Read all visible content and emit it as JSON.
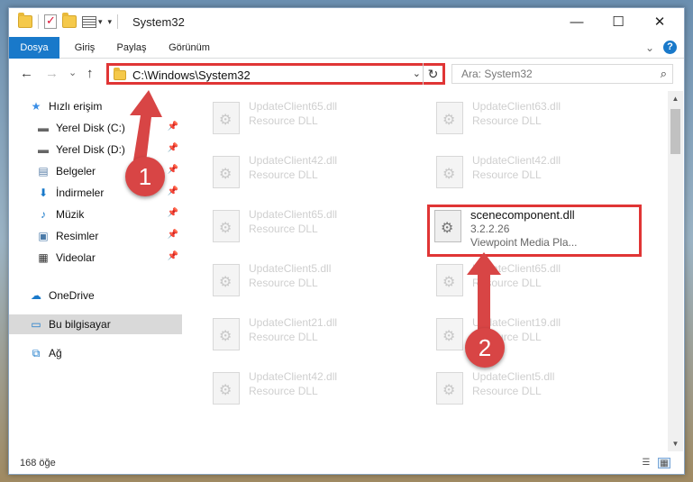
{
  "window": {
    "title": "System32",
    "controls": {
      "minimize": "—",
      "maximize": "☐",
      "close": "✕"
    }
  },
  "ribbon": {
    "tabs": [
      {
        "label": "Dosya",
        "active": true
      },
      {
        "label": "Giriş",
        "active": false
      },
      {
        "label": "Paylaş",
        "active": false
      },
      {
        "label": "Görünüm",
        "active": false
      }
    ],
    "expand_glyph": "⌄",
    "help_glyph": "?"
  },
  "navigation": {
    "back": "←",
    "forward": "→",
    "recent": "⌄",
    "up": "↑",
    "address_path": "C:\\Windows\\System32",
    "address_dropdown": "⌄",
    "refresh": "↻",
    "search_placeholder": "Ara: System32",
    "search_glyph": "⌕"
  },
  "sidebar": {
    "items": [
      {
        "label": "Hızlı erişim",
        "icon": "★",
        "pinned": false
      },
      {
        "label": "Yerel Disk (C:)",
        "icon": "▬",
        "pinned": true
      },
      {
        "label": "Yerel Disk (D:)",
        "icon": "▬",
        "pinned": true
      },
      {
        "label": "Belgeler",
        "icon": "▤",
        "pinned": true
      },
      {
        "label": "İndirmeler",
        "icon": "⬇",
        "pinned": true
      },
      {
        "label": "Müzik",
        "icon": "♪",
        "pinned": true
      },
      {
        "label": "Resimler",
        "icon": "▣",
        "pinned": true
      },
      {
        "label": "Videolar",
        "icon": "▦",
        "pinned": true
      },
      {
        "label": "OneDrive",
        "icon": "☁",
        "pinned": false
      },
      {
        "label": "Bu bilgisayar",
        "icon": "▭",
        "pinned": false,
        "selected": true
      },
      {
        "label": "Ağ",
        "icon": "⧉",
        "pinned": false
      }
    ],
    "pin_glyph": "📌"
  },
  "files": [
    {
      "name": "UpdateClient65.dll",
      "type": "Resource DLL"
    },
    {
      "name": "UpdateClient63.dll",
      "type": "Resource DLL"
    },
    {
      "name": "UpdateClient42.dll",
      "type": "Resource DLL"
    },
    {
      "name": "UpdateClient42.dll",
      "type": "Resource DLL"
    },
    {
      "name": "UpdateClient65.dll",
      "type": "Resource DLL"
    },
    {
      "name": "scenecomponent.dll",
      "version": "3.2.2.26",
      "company": "Viewpoint Media Pla...",
      "highlighted": true
    },
    {
      "name": "UpdateClient5.dll",
      "type": "Resource DLL"
    },
    {
      "name": "UpdateClient65.dll",
      "type": "Resource DLL"
    },
    {
      "name": "UpdateClient21.dll",
      "type": "Resource DLL"
    },
    {
      "name": "UpdateClient19.dll",
      "type": "Resource DLL"
    },
    {
      "name": "UpdateClient42.dll",
      "type": "Resource DLL"
    },
    {
      "name": "UpdateClient5.dll",
      "type": "Resource DLL"
    }
  ],
  "status": {
    "item_count": "168 öğe"
  },
  "annotations": [
    {
      "label": "1"
    },
    {
      "label": "2"
    }
  ],
  "colors": {
    "accent": "#1979ca",
    "highlight": "#e03535",
    "marker": "#d84545"
  }
}
